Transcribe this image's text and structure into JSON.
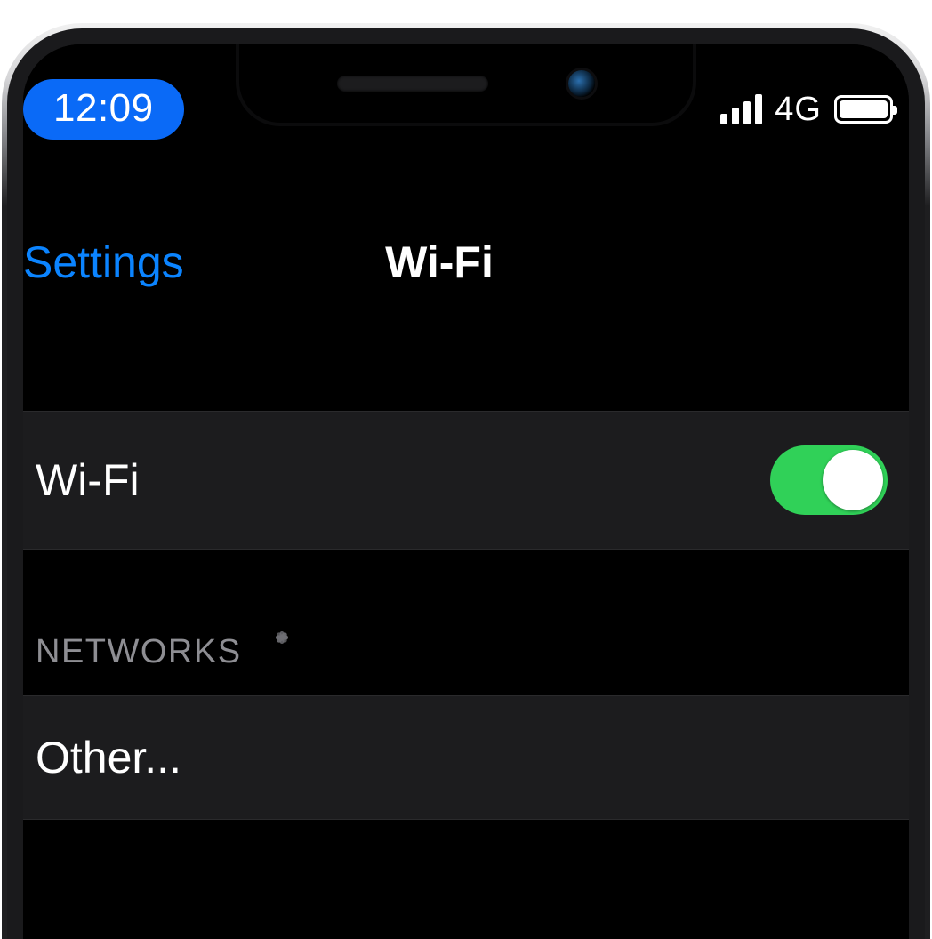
{
  "status_bar": {
    "time": "12:09",
    "network_type": "4G"
  },
  "nav": {
    "back_label": "Settings",
    "title": "Wi-Fi"
  },
  "wifi_row": {
    "label": "Wi-Fi",
    "enabled": true
  },
  "networks_section": {
    "header": "NETWORKS",
    "other_label": "Other..."
  },
  "colors": {
    "accent_link": "#0b84ff",
    "toggle_on": "#30d158",
    "time_pill": "#0a6af7",
    "cell_bg": "#1c1c1e",
    "section_text": "#8e8e93"
  }
}
